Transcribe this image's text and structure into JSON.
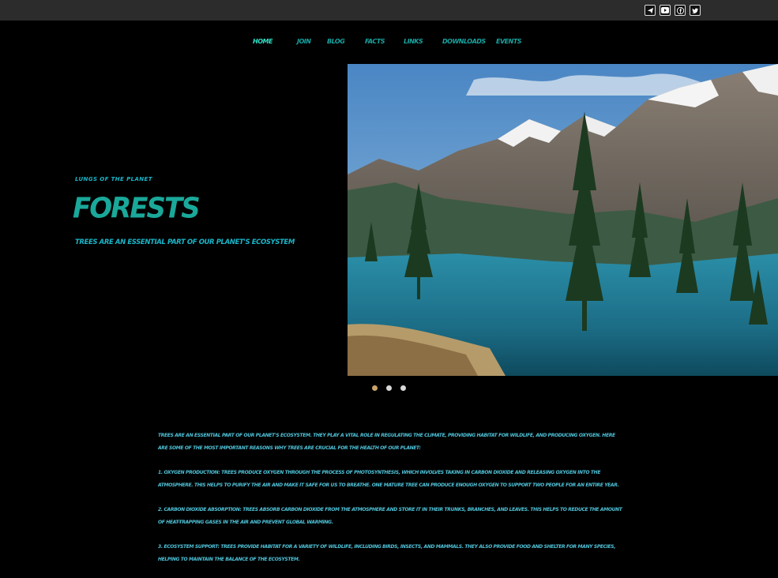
{
  "social": [
    {
      "name": "telegram-icon",
      "glyph": "➤"
    },
    {
      "name": "youtube-icon",
      "glyph": "▶"
    },
    {
      "name": "facebook-icon",
      "glyph": "f"
    },
    {
      "name": "twitter-icon",
      "glyph": "t"
    }
  ],
  "nav": {
    "home": "Home",
    "join": "Join",
    "blog": "Blog",
    "facts": "Facts",
    "links": "Links",
    "downloads": "Downloads",
    "events": "Events"
  },
  "hero": {
    "tagline": "Lungs of the planet",
    "title": "Forests",
    "subtitle": "Trees are an essential part of our planet's ecosystem"
  },
  "slider": {
    "slide_count": 3,
    "active_index": 0
  },
  "article": {
    "intro": "Trees are an essential part of our planet's ecosystem. They play a vital role in regulating the climate, providing habitat for wildlife, and producing oxygen. Here are some of the most important reasons why trees are crucial for the health of our planet:",
    "point1": "1. Oxygen production: Trees produce oxygen through the process of photosynthesis, which involves taking in carbon dioxide and releasing oxygen into the atmosphere. This helps to purify the air and make it safe for us to breathe. One mature tree can produce enough oxygen to support two people for an entire year.",
    "point2": "2. Carbon dioxide absorption: Trees absorb carbon dioxide from the atmosphere and store it in their trunks, branches, and leaves. This helps to reduce the amount of heat-trapping gases in the air and prevent global warming.",
    "point3": "3. Ecosystem support: Trees provide habitat for a variety of wildlife, including birds, insects, and mammals. They also provide food and shelter for many species, helping to maintain the balance of the ecosystem."
  },
  "colors": {
    "nav_text": "#18a4a0",
    "nav_active": "#2fe0c8",
    "title": "#1aa89a",
    "accent_text": "#19b5c8",
    "dot_active": "#c8a46a"
  }
}
